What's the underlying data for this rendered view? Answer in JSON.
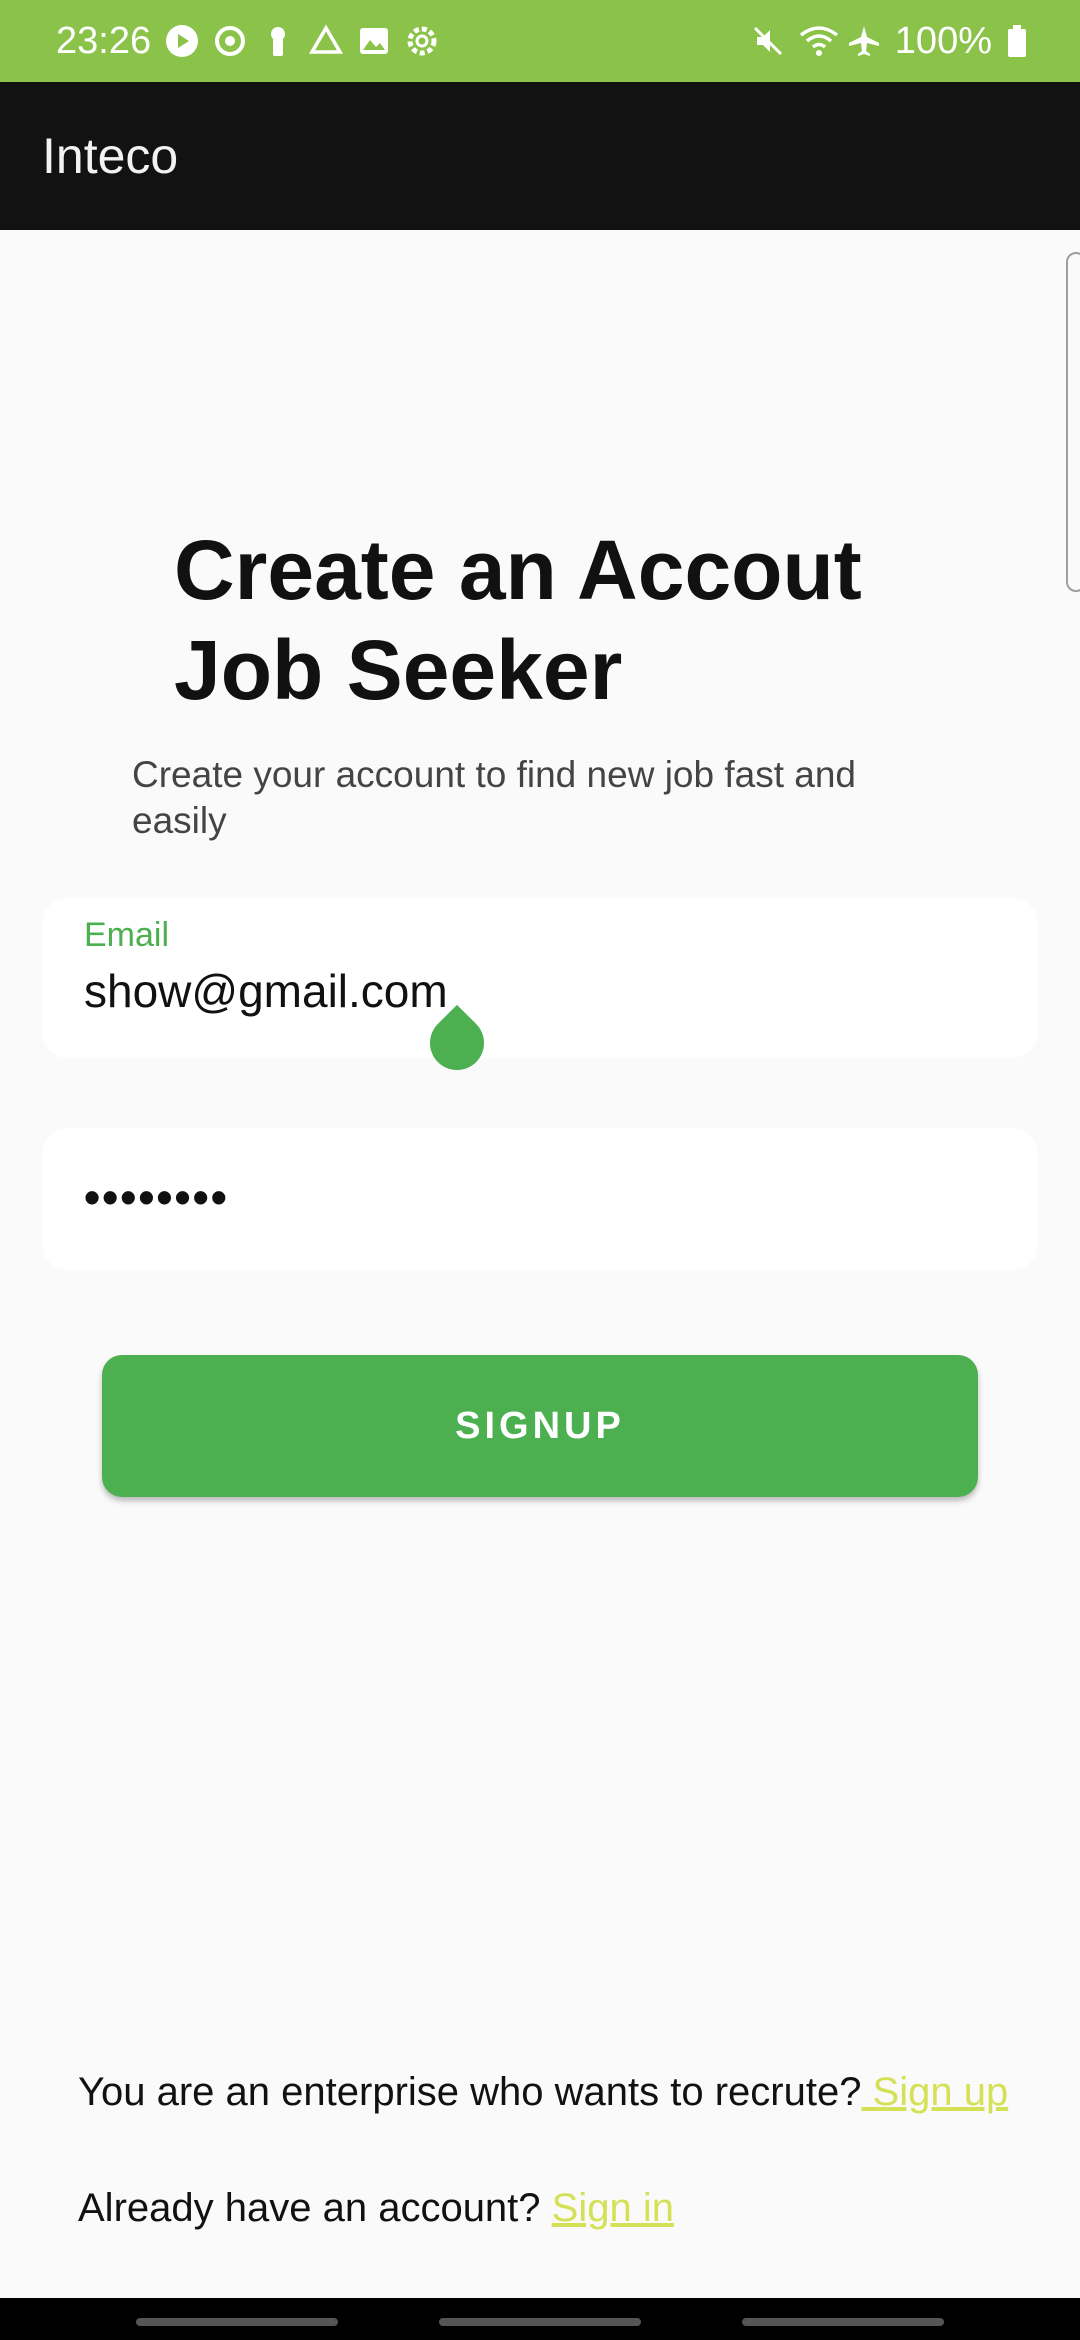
{
  "status_bar": {
    "time": "23:26",
    "battery": "100%",
    "background_color": "#8bc34a",
    "left_icons": [
      "play-icon",
      "sync-icon",
      "keyhole-icon",
      "drive-icon",
      "image-icon",
      "settings-icon"
    ],
    "right_icons": [
      "mute-icon",
      "wifi-icon",
      "airplane-icon",
      "battery-icon"
    ]
  },
  "app_bar": {
    "title": "Inteco",
    "background_color": "#121212"
  },
  "main": {
    "heading": "Create an Accout Job Seeker",
    "heading_line1": "Create an Accout",
    "heading_line2": "Job Seeker",
    "subtitle": "Create your account to find new job fast and easily"
  },
  "form": {
    "email": {
      "label": "Email",
      "value": "show@gmail.com"
    },
    "password": {
      "value": "••••••••"
    },
    "signup_label": "SIGNUP",
    "accent_color": "#4caf50"
  },
  "footer": {
    "enterprise_text": "You are an enterprise who wants to recrute?",
    "enterprise_link": " Sign up",
    "account_text": "Already have an account? ",
    "account_link": "Sign in",
    "link_color": "#d4e157"
  }
}
